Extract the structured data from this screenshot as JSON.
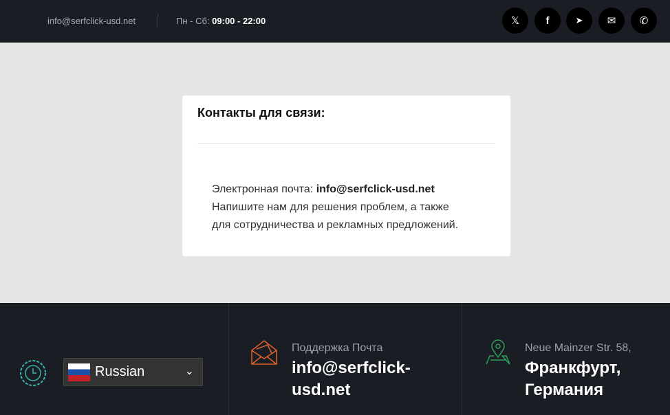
{
  "topbar": {
    "email": "info@serfclick-usd.net",
    "hours_label": "Пн - Сб:",
    "hours_value": "09:00 - 22:00",
    "social": [
      {
        "icon": "x-icon",
        "glyph": "𝕏"
      },
      {
        "icon": "facebook-icon",
        "glyph": "f"
      },
      {
        "icon": "telegram-icon",
        "glyph": "➤"
      },
      {
        "icon": "mail-icon",
        "glyph": "✉"
      },
      {
        "icon": "whatsapp-icon",
        "glyph": "✆"
      }
    ]
  },
  "card": {
    "title": "Контакты для связи:",
    "email_label": "Электронная почта:",
    "email": "info@serfclick-usd.net",
    "line2": "Напишите нам для решения проблем, а также",
    "line3": "для сотрудничества и рекламных предложений."
  },
  "footer": {
    "language": "Russian",
    "support_label": "Поддержка Почта",
    "support_email": "info@serfclick-usd.net",
    "address_line": "Neue Mainzer Str. 58,",
    "city": "Франкфурт, Германия"
  },
  "colors": {
    "dark": "#1a1d23",
    "teal": "#3ab5b0",
    "orange": "#e0622c",
    "green": "#2e9e5a"
  }
}
